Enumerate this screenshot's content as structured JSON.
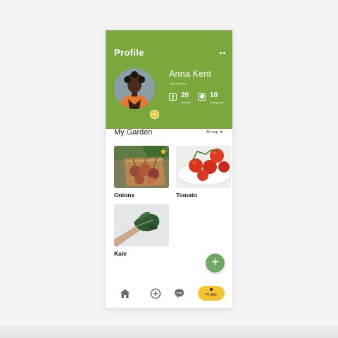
{
  "header": {
    "title": "Profile",
    "more_icon": "more-dots-icon"
  },
  "user": {
    "name": "Anna Kent",
    "location": "San francisco",
    "stats": [
      {
        "value": "20",
        "label": "Harvest",
        "icon": "user-card-icon"
      },
      {
        "value": "10",
        "label": "Overgrown",
        "icon": "tag-icon"
      }
    ]
  },
  "garden": {
    "title": "My Garden",
    "filter": "All crop",
    "crops": [
      {
        "name": "Onions",
        "favorite": true
      },
      {
        "name": "Tomato",
        "favorite": false
      },
      {
        "name": "Kale",
        "favorite": false
      }
    ]
  },
  "fab": {
    "label": "+",
    "icon": "plus-icon"
  },
  "nav": {
    "items": [
      {
        "icon": "home-icon"
      },
      {
        "icon": "add-circle-icon"
      },
      {
        "icon": "chat-icon"
      },
      {
        "label": "Profile",
        "icon": "profile-dot-icon",
        "active": true
      }
    ]
  },
  "colors": {
    "brand_green": "#7ba83c",
    "accent_yellow": "#f4c430",
    "fab_green": "#6fa866"
  }
}
